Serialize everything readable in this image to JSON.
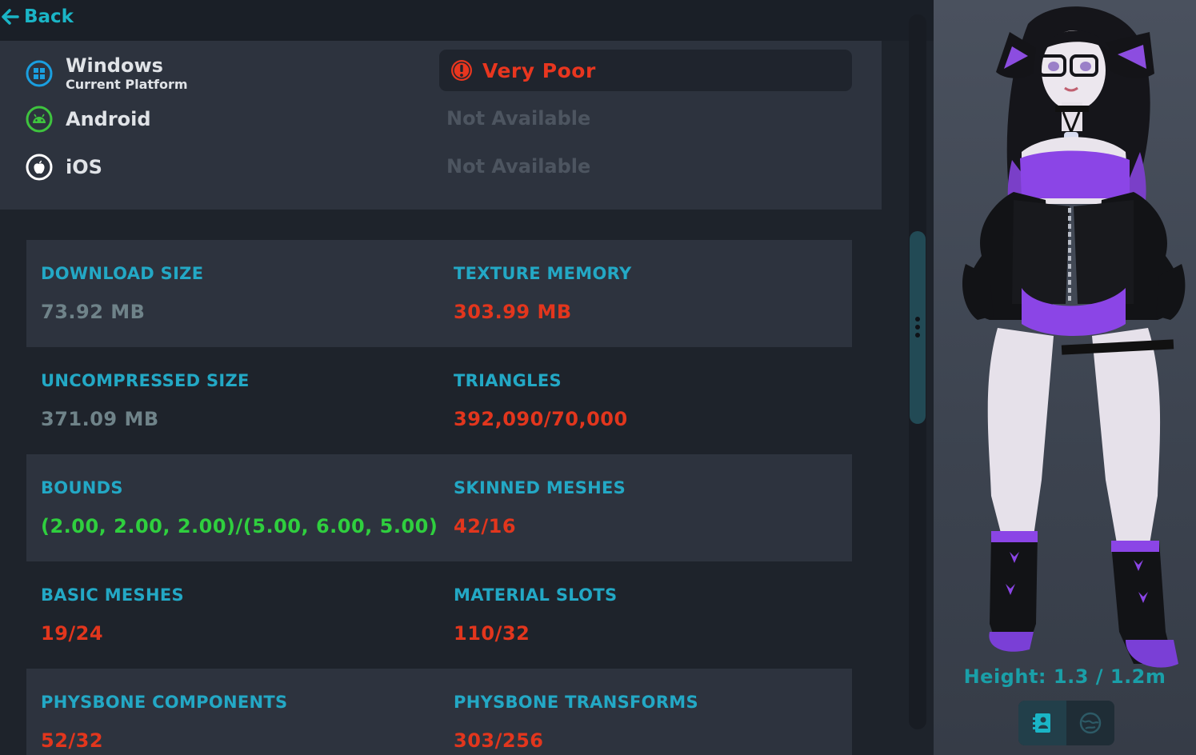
{
  "nav": {
    "back_label": "Back"
  },
  "platforms": [
    {
      "name": "Windows",
      "subtitle": "Current Platform",
      "icon": "windows-icon",
      "status": "Very Poor",
      "status_icon": "alert-icon"
    },
    {
      "name": "Android",
      "icon": "android-icon",
      "status": "Not Available"
    },
    {
      "name": "iOS",
      "icon": "apple-icon",
      "status": "Not Available"
    }
  ],
  "stats": [
    [
      {
        "label": "DOWNLOAD SIZE",
        "value": "73.92 MB",
        "color": "gray"
      },
      {
        "label": "TEXTURE MEMORY",
        "value": "303.99 MB",
        "color": "red"
      }
    ],
    [
      {
        "label": "UNCOMPRESSED SIZE",
        "value": "371.09 MB",
        "color": "gray"
      },
      {
        "label": "TRIANGLES",
        "value": "392,090/70,000",
        "color": "red"
      }
    ],
    [
      {
        "label": "BOUNDS",
        "value": "(2.00, 2.00, 2.00)/(5.00, 6.00, 5.00)",
        "color": "green"
      },
      {
        "label": "SKINNED MESHES",
        "value": "42/16",
        "color": "red"
      }
    ],
    [
      {
        "label": "BASIC MESHES",
        "value": "19/24",
        "color": "red"
      },
      {
        "label": "MATERIAL SLOTS",
        "value": "110/32",
        "color": "red"
      }
    ],
    [
      {
        "label": "PHYSBONE COMPONENTS",
        "value": "52/32",
        "color": "red"
      },
      {
        "label": "PHYSBONE TRANSFORMS",
        "value": "303/256",
        "color": "red"
      }
    ]
  ],
  "avatar": {
    "height_label": "Height: 1.3 / 1.2m",
    "buttons": [
      {
        "icon": "avatar-details-icon",
        "active": true
      },
      {
        "icon": "globe-icon",
        "active": false
      }
    ]
  },
  "colors": {
    "accent": "#1ab5c6",
    "label": "#23a8c5",
    "red": "#e2361d",
    "green": "#2fcf3e",
    "gray": "#6f8389"
  }
}
